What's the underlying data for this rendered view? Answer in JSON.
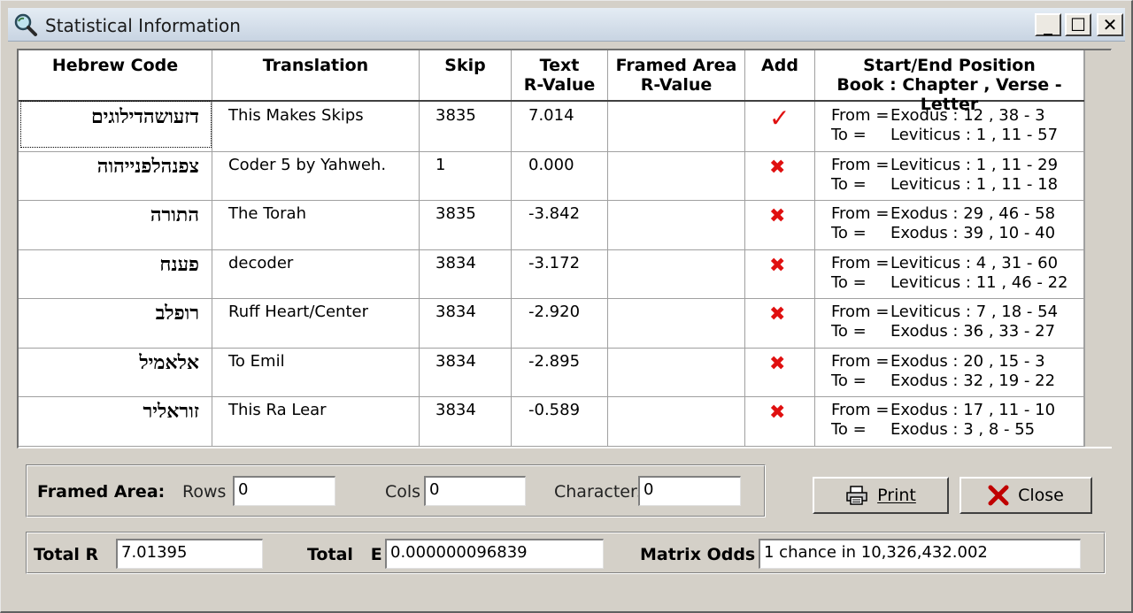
{
  "window": {
    "title": "Statistical Information",
    "minimize_glyph": "_",
    "maximize_glyph": "☐",
    "close_glyph": "✕"
  },
  "grid": {
    "columns": [
      {
        "line1": "Hebrew Code",
        "line2": ""
      },
      {
        "line1": "Translation",
        "line2": ""
      },
      {
        "line1": "Skip",
        "line2": ""
      },
      {
        "line1": "Text",
        "line2": "R-Value"
      },
      {
        "line1": "Framed Area",
        "line2": "R-Value"
      },
      {
        "line1": "Add",
        "line2": ""
      },
      {
        "line1": "Start/End Position",
        "line2": "Book : Chapter , Verse - Letter"
      }
    ],
    "rows": [
      {
        "hebrew": "דזעושהדילוגים",
        "translation": "This Makes Skips",
        "skip": "3835",
        "text_r": "7.014",
        "framed_r": "",
        "add": "✓",
        "add_icon": "checkmark-icon",
        "from_label": "From =",
        "from": "Exodus : 12 , 38 - 3",
        "to_label": "To =",
        "to": "Leviticus : 1 , 11 - 57"
      },
      {
        "hebrew": "צפנהלפנייהוה",
        "translation": "Coder 5 by Yahweh.",
        "skip": "1",
        "text_r": "0.000",
        "framed_r": "",
        "add": "✖",
        "add_icon": "x-mark-icon",
        "from_label": "From =",
        "from": "Leviticus : 1 , 11 - 29",
        "to_label": "To =",
        "to": "Leviticus : 1 , 11 - 18"
      },
      {
        "hebrew": "התורה",
        "translation": "The Torah",
        "skip": "3835",
        "text_r": "-3.842",
        "framed_r": "",
        "add": "✖",
        "add_icon": "x-mark-icon",
        "from_label": "From =",
        "from": "Exodus : 29 , 46 - 58",
        "to_label": "To =",
        "to": "Exodus : 39 , 10 - 40"
      },
      {
        "hebrew": "פענח",
        "translation": "decoder",
        "skip": "3834",
        "text_r": "-3.172",
        "framed_r": "",
        "add": "✖",
        "add_icon": "x-mark-icon",
        "from_label": "From =",
        "from": "Leviticus : 4 , 31 - 60",
        "to_label": "To =",
        "to": "Leviticus : 11 , 46 - 22"
      },
      {
        "hebrew": "רופלב",
        "translation": "Ruff Heart/Center",
        "skip": "3834",
        "text_r": "-2.920",
        "framed_r": "",
        "add": "✖",
        "add_icon": "x-mark-icon",
        "from_label": "From =",
        "from": "Leviticus : 7 , 18 - 54",
        "to_label": "To =",
        "to": "Exodus : 36 , 33 - 27"
      },
      {
        "hebrew": "אלאמיל",
        "translation": "To Emil",
        "skip": "3834",
        "text_r": "-2.895",
        "framed_r": "",
        "add": "✖",
        "add_icon": "x-mark-icon",
        "from_label": "From =",
        "from": "Exodus : 20 , 15 - 3",
        "to_label": "To =",
        "to": "Exodus : 32 , 19 - 22"
      },
      {
        "hebrew": "זוראליר",
        "translation": "This Ra Lear",
        "skip": "3834",
        "text_r": "-0.589",
        "framed_r": "",
        "add": "✖",
        "add_icon": "x-mark-icon",
        "from_label": "From =",
        "from": "Exodus : 17 , 11 - 10",
        "to_label": "To =",
        "to": "Exodus : 3 , 8 - 55"
      }
    ]
  },
  "framed_area": {
    "label": "Framed Area:",
    "rows_label": "Rows",
    "rows_value": "0",
    "cols_label": "Cols",
    "cols_value": "0",
    "chars_label": "Characters",
    "chars_value": "0"
  },
  "buttons": {
    "print_label": "Print",
    "close_label": "Close"
  },
  "totals": {
    "total_r_label": "Total R",
    "total_r_value": "7.01395",
    "total_e_label": "Total   E",
    "total_e_value": "0.000000096839",
    "odds_label": "Matrix Odds",
    "odds_value": "1 chance in 10,326,432.002"
  },
  "colors": {
    "accent_red": "#e01010",
    "titlebar": "#d0dae6",
    "dialog": "#d4d0c8"
  }
}
